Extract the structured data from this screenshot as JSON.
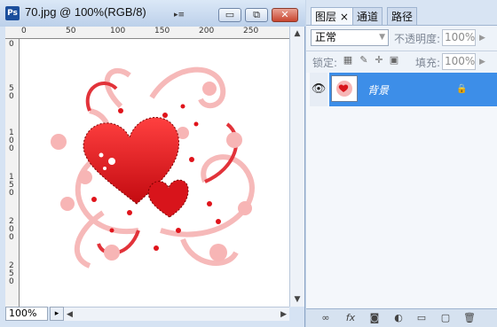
{
  "document": {
    "title": "70.jpg @ 100%(RGB/8)",
    "app_icon": "Ps",
    "zoom": "100%",
    "controls": {
      "minimize": "▭",
      "restore": "⧉",
      "close": "✕"
    },
    "ruler_top": [
      "0",
      "50",
      "100",
      "150",
      "200",
      "250"
    ],
    "ruler_left": [
      [
        "0"
      ],
      [
        "5",
        "0"
      ],
      [
        "1",
        "0",
        "0"
      ],
      [
        "1",
        "5",
        "0"
      ],
      [
        "2",
        "0",
        "0"
      ],
      [
        "2",
        "5",
        "0"
      ]
    ]
  },
  "layers_panel": {
    "tabs": [
      "图层",
      "通道",
      "路径"
    ],
    "tab_close": "×",
    "menu_icon": "▸≡",
    "blend_mode": "正常",
    "opacity_label": "不透明度:",
    "opacity_value": "100%",
    "lock_label": "锁定:",
    "fill_label": "填充:",
    "fill_value": "100%",
    "layers": [
      {
        "name": "背景",
        "visible": true,
        "locked": true
      }
    ]
  },
  "colors": {
    "selection": "#3d8ee8",
    "accent_red": "#d8141b"
  }
}
